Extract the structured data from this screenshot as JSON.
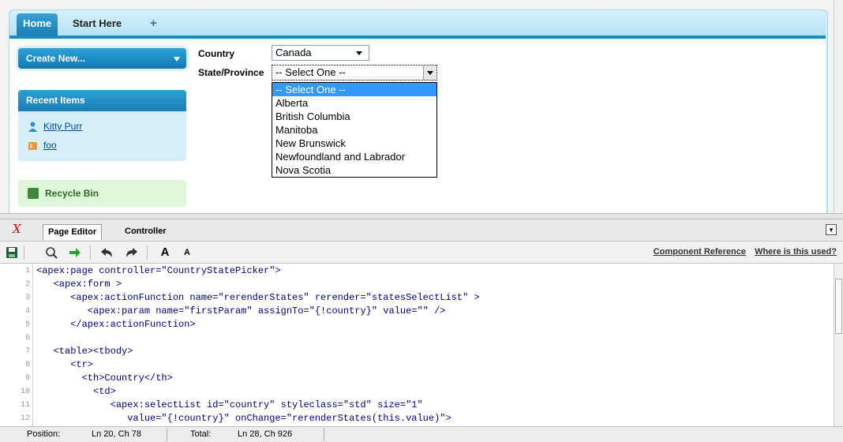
{
  "tabs": {
    "home": "Home",
    "start_here": "Start Here",
    "plus": "+"
  },
  "sidebar": {
    "create_new": "Create New...",
    "recent_items_title": "Recent Items",
    "recent_items": [
      "Kitty Purr",
      "foo"
    ],
    "recycle_bin": "Recycle Bin"
  },
  "form": {
    "country_label": "Country",
    "country_value": "Canada",
    "state_label": "State/Province",
    "state_value": "-- Select One --",
    "state_options": [
      "-- Select One --",
      "Alberta",
      "British Columbia",
      "Manitoba",
      "New Brunswick",
      "Newfoundland and Labrador",
      "Nova Scotia"
    ]
  },
  "dev": {
    "tabs": {
      "page_editor": "Page Editor",
      "controller": "Controller"
    },
    "toolbar": {
      "font_up": "A",
      "font_down": "A"
    },
    "links": {
      "component_reference": "Component Reference",
      "where_used": "Where is this used?"
    },
    "code_lines": [
      {
        "n": "1",
        "t": "<apex:page controller=\"CountryStatePicker\">"
      },
      {
        "n": "2",
        "t": "   <apex:form >"
      },
      {
        "n": "3",
        "t": "      <apex:actionFunction name=\"rerenderStates\" rerender=\"statesSelectList\" >"
      },
      {
        "n": "4",
        "t": "         <apex:param name=\"firstParam\" assignTo=\"{!country}\" value=\"\" />"
      },
      {
        "n": "5",
        "t": "      </apex:actionFunction>"
      },
      {
        "n": "6",
        "t": ""
      },
      {
        "n": "7",
        "t": "   <table><tbody>"
      },
      {
        "n": "8",
        "t": "      <tr>"
      },
      {
        "n": "9",
        "t": "        <th>Country</th>"
      },
      {
        "n": "10",
        "t": "          <td>"
      },
      {
        "n": "11",
        "t": "             <apex:selectList id=\"country\" styleclass=\"std\" size=\"1\""
      },
      {
        "n": "12",
        "t": "                value=\"{!country}\" onChange=\"rerenderStates(this.value)\">"
      }
    ],
    "status": {
      "position_label": "Position:",
      "position_value": "Ln 20, Ch 78",
      "total_label": "Total:",
      "total_value": "Ln 28, Ch 926"
    }
  }
}
